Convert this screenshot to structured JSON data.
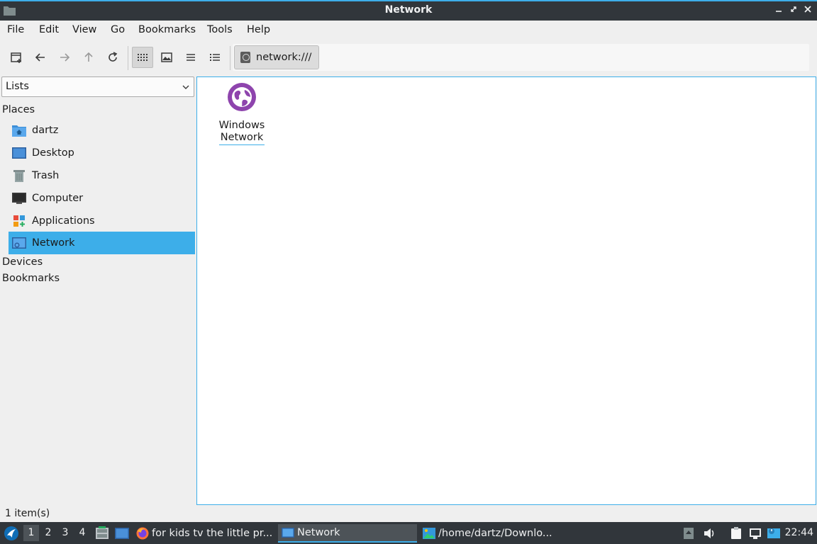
{
  "window": {
    "title": "Network",
    "controls": [
      "minimize",
      "maximize",
      "close"
    ]
  },
  "menu": [
    "File",
    "Edit",
    "View",
    "Go",
    "Bookmarks",
    "Tools",
    "Help"
  ],
  "toolbar": {
    "buttons": [
      "new-tab-icon",
      "back-arrow-icon",
      "forward-arrow-icon",
      "up-arrow-icon",
      "reload-icon",
      "icon-view-icon",
      "thumbnail-view-icon",
      "compact-view-icon",
      "detailed-list-icon"
    ],
    "active_view": "icon-view",
    "path": "network:///"
  },
  "sidebar": {
    "mode": "Lists",
    "sections": {
      "places": "Places",
      "devices": "Devices",
      "bookmarks": "Bookmarks"
    },
    "places": [
      {
        "label": "dartz",
        "icon": "home-folder-icon"
      },
      {
        "label": "Desktop",
        "icon": "desktop-icon"
      },
      {
        "label": "Trash",
        "icon": "trash-icon"
      },
      {
        "label": "Computer",
        "icon": "computer-icon"
      },
      {
        "label": "Applications",
        "icon": "applications-icon"
      },
      {
        "label": "Network",
        "icon": "network-icon",
        "selected": true
      }
    ]
  },
  "files": [
    {
      "name_line1": "Windows",
      "name_line2": "Network",
      "icon": "globe-network-icon"
    }
  ],
  "status": "1 item(s)",
  "taskbar": {
    "desktops": [
      "1",
      "2",
      "3",
      "4"
    ],
    "current_desktop": "1",
    "tasks": [
      {
        "label": "for kids tv the little pr...",
        "icon": "firefox-icon"
      },
      {
        "label": "Network",
        "icon": "folder-icon",
        "active": true
      },
      {
        "label": "/home/dartz/Downlo...",
        "icon": "image-viewer-icon"
      }
    ],
    "clock": "22:44"
  },
  "colors": {
    "accent": "#3daee9",
    "titlebar": "#31363b",
    "network_purple": "#8e44ad"
  }
}
